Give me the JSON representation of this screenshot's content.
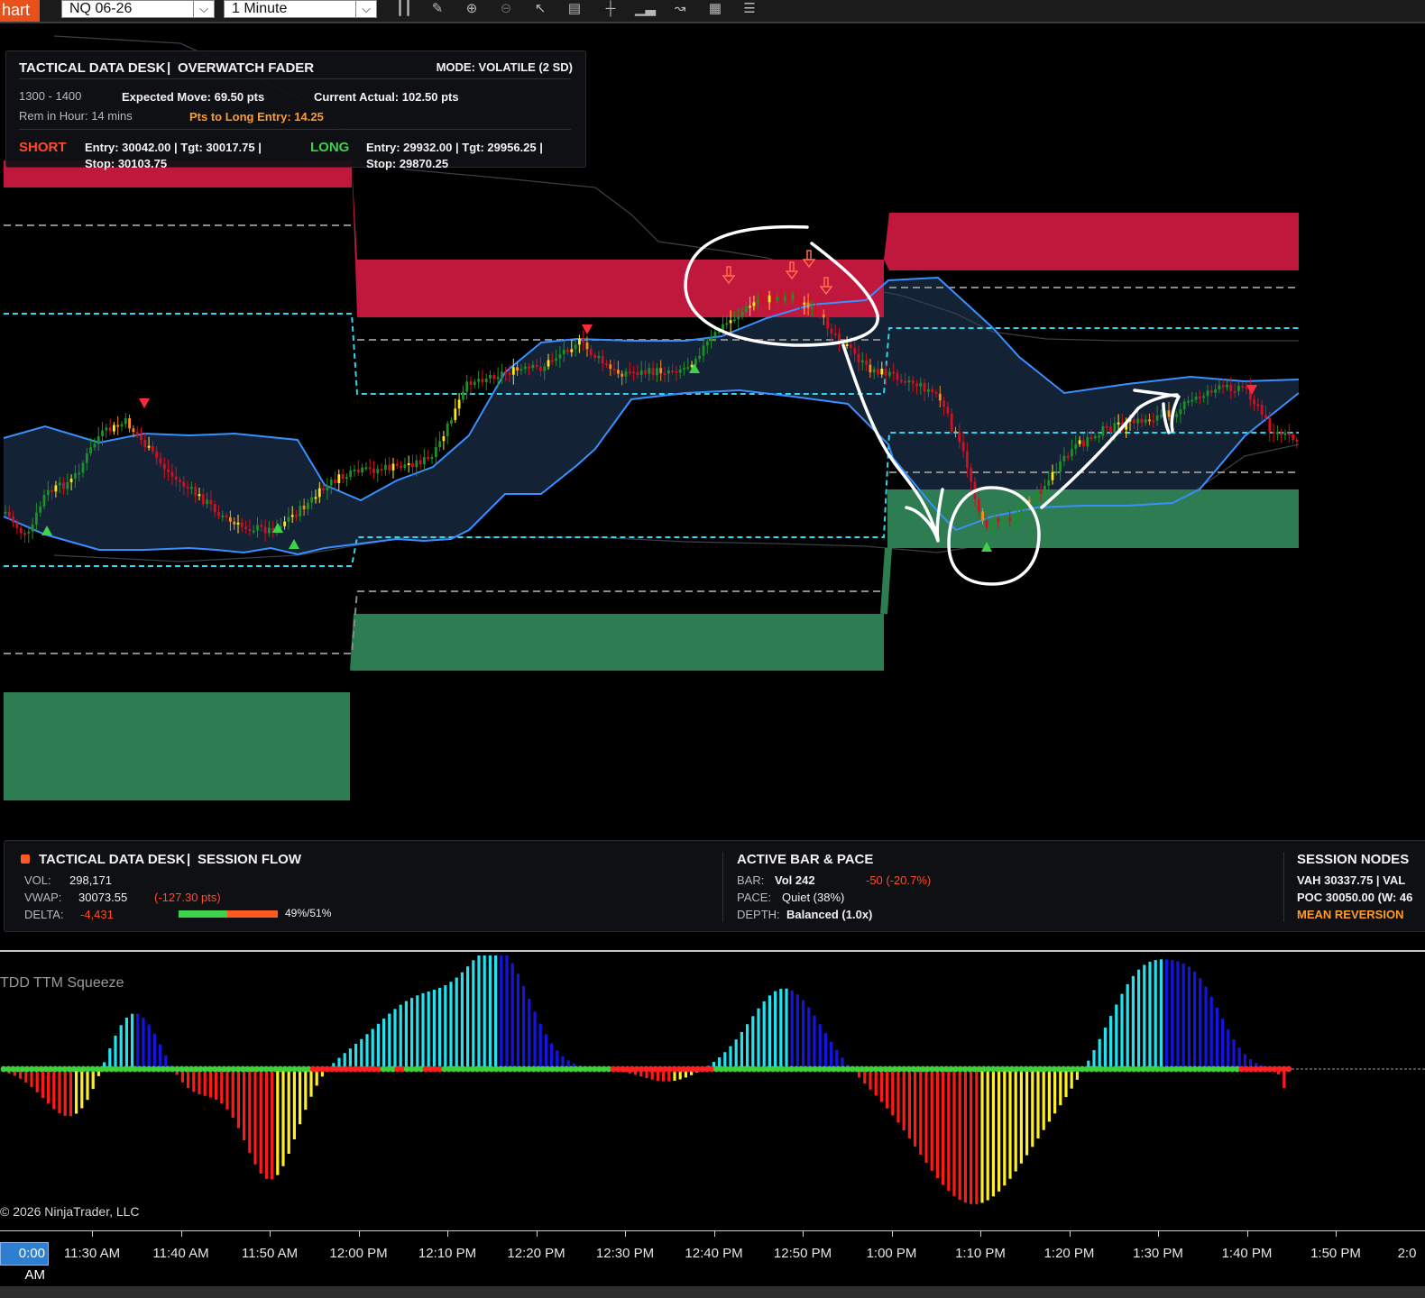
{
  "toolbar": {
    "tab_label": "hart",
    "instrument": "NQ 06-26",
    "interval": "1 Minute",
    "tools": [
      "bar-type-icon",
      "pencil-icon",
      "zoom-in-icon",
      "zoom-out-icon",
      "pointer-icon",
      "data-box-icon",
      "crosshair-icon",
      "indicators-icon",
      "strategies-icon",
      "templates-icon",
      "properties-icon"
    ]
  },
  "overwatch": {
    "title": "TACTICAL DATA DESK",
    "subtitle": "OVERWATCH FADER",
    "mode": "MODE: VOLATILE (2 SD)",
    "hour_range": "1300 - 1400",
    "remaining": "Rem in Hour: 14 mins",
    "expected_move": "Expected Move: 69.50 pts",
    "pts_to_long": "Pts to Long Entry: 14.25",
    "current_actual": "Current Actual: 102.50 pts",
    "short_label": "SHORT",
    "short_line1": "Entry: 30042.00  |  Tgt: 30017.75  |",
    "short_line2": "Stop: 30103.75",
    "long_label": "LONG",
    "long_line1": "Entry: 29932.00  |  Tgt: 29956.25  |",
    "long_line2": "Stop: 29870.25",
    "colors": {
      "short": "#ff4b2b",
      "long": "#3ed14b",
      "accent": "#ff9b2b"
    }
  },
  "session_flow": {
    "title": "TACTICAL DATA DESK",
    "subtitle": "SESSION FLOW",
    "vol_label": "VOL:",
    "vol_value": "298,171",
    "vwap_label": "VWAP:",
    "vwap_value": "30073.55",
    "vwap_diff": "(-127.30 pts)",
    "delta_label": "DELTA:",
    "delta_value": "-4,431",
    "delta_split": "49%/51%",
    "delta_buy_fraction": 0.49
  },
  "active_bar": {
    "title": "ACTIVE BAR & PACE",
    "bar_label": "BAR:",
    "bar_value": "Vol 242",
    "bar_diff": "-50 (-20.7%)",
    "pace_label": "PACE:",
    "pace_value": "Quiet (38%)",
    "depth_label": "DEPTH:",
    "depth_value": "Balanced (1.0x)"
  },
  "session_nodes": {
    "title": "SESSION NODES",
    "line1": "VAH 30337.75  |  VAL",
    "line2": "POC 30050.00 (W: 46",
    "status": "MEAN REVERSION"
  },
  "oscillator": {
    "title": "TDD TTM Squeeze",
    "copyright": "© 2026 NinjaTrader, LLC"
  },
  "time_axis": {
    "labels": [
      "11:30 AM",
      "11:40 AM",
      "11:50 AM",
      "12:00 PM",
      "12:10 PM",
      "12:20 PM",
      "12:30 PM",
      "12:40 PM",
      "12:50 PM",
      "1:00 PM",
      "1:10 PM",
      "1:20 PM",
      "1:30 PM",
      "1:40 PM",
      "1:50 PM",
      "2:0"
    ],
    "highlight": "0:00 AM"
  }
}
